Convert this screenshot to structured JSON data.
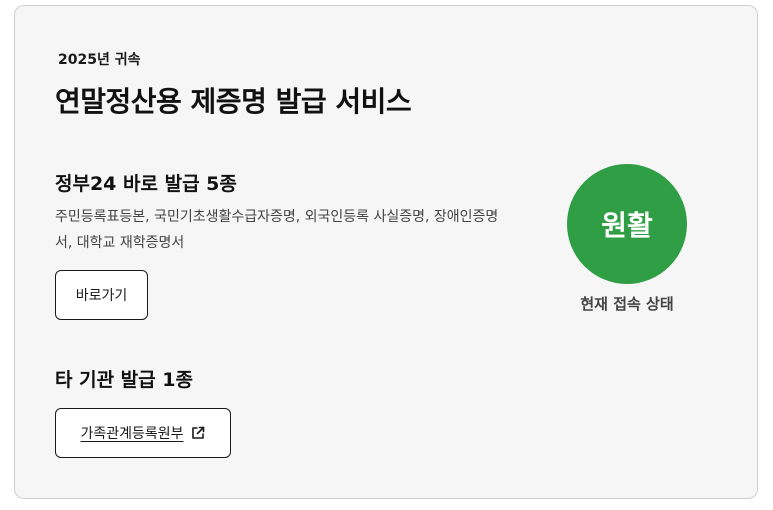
{
  "card": {
    "year_tag": "2025년 귀속",
    "title": "연말정산용 제증명 발급 서비스"
  },
  "section_gov24": {
    "title": "정부24 바로 발급 5종",
    "description": "주민등록표등본, 국민기초생활수급자증명, 외국인등록 사실증명, 장애인증명서, 대학교 재학증명서",
    "button_label": "바로가기"
  },
  "section_other": {
    "title": "타 기관 발급 1종",
    "button_label": "가족관계등록원부",
    "button_icon": "external-link-icon"
  },
  "status": {
    "value": "원활",
    "label": "현재 접속 상태",
    "color": "#2f9e44"
  }
}
